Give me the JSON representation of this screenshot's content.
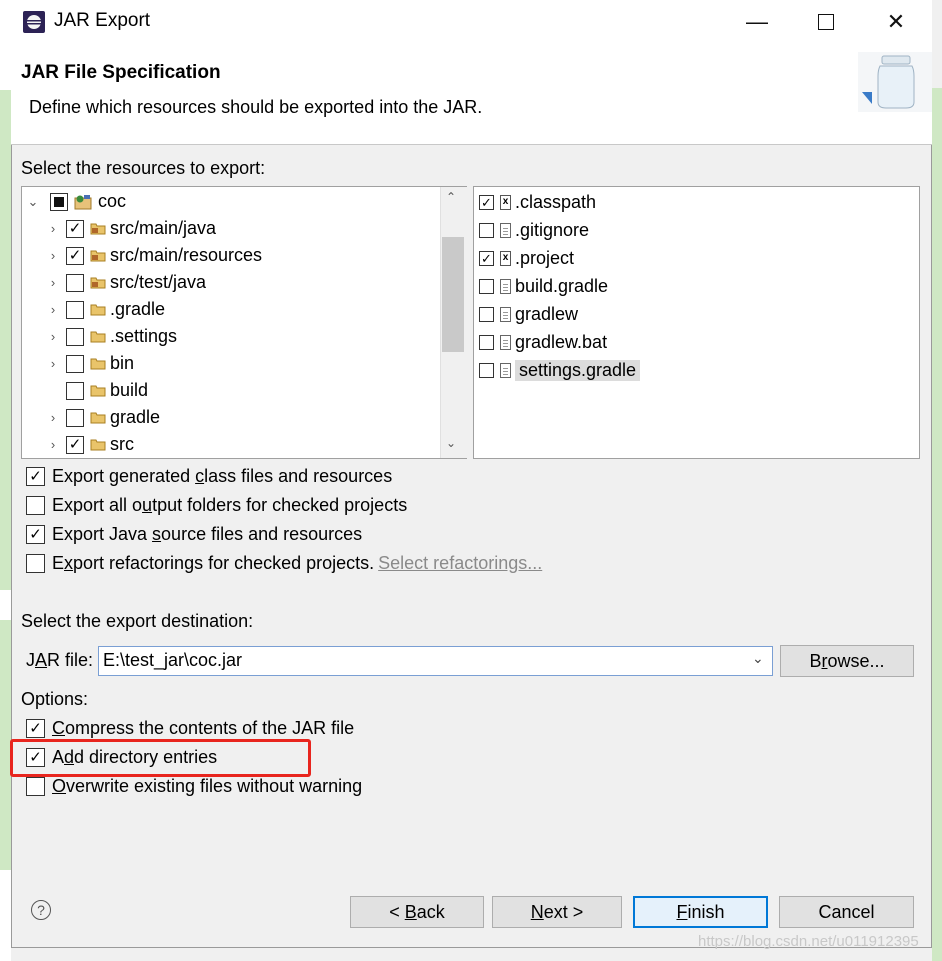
{
  "window": {
    "title": "JAR Export",
    "minimize_icon": "minimize-icon",
    "maximize_icon": "maximize-icon",
    "close_icon": "close-icon"
  },
  "header": {
    "title": "JAR File Specification",
    "description": "Define which resources should be exported into the JAR."
  },
  "resources": {
    "label": "Select the resources to export:",
    "tree": [
      {
        "label": "coc",
        "state": "partial",
        "icon": "project-icon",
        "expanded": true
      },
      {
        "label": "src/main/java",
        "state": "checked",
        "icon": "package-folder-icon"
      },
      {
        "label": "src/main/resources",
        "state": "checked",
        "icon": "package-folder-icon"
      },
      {
        "label": "src/test/java",
        "state": "unchecked",
        "icon": "package-folder-icon"
      },
      {
        "label": ".gradle",
        "state": "unchecked",
        "icon": "folder-icon"
      },
      {
        "label": ".settings",
        "state": "unchecked",
        "icon": "folder-icon"
      },
      {
        "label": "bin",
        "state": "unchecked",
        "icon": "folder-icon"
      },
      {
        "label": "build",
        "state": "unchecked",
        "icon": "folder-icon"
      },
      {
        "label": "gradle",
        "state": "unchecked",
        "icon": "folder-icon"
      },
      {
        "label": "src",
        "state": "checked",
        "icon": "folder-icon"
      }
    ],
    "files": [
      {
        "label": ".classpath",
        "checked": true,
        "icon": "xml-file-icon"
      },
      {
        "label": ".gitignore",
        "checked": false,
        "icon": "text-file-icon"
      },
      {
        "label": ".project",
        "checked": true,
        "icon": "xml-file-icon"
      },
      {
        "label": "build.gradle",
        "checked": false,
        "icon": "text-file-icon"
      },
      {
        "label": "gradlew",
        "checked": false,
        "icon": "text-file-icon"
      },
      {
        "label": "gradlew.bat",
        "checked": false,
        "icon": "text-file-icon"
      },
      {
        "label": "settings.gradle",
        "checked": false,
        "icon": "text-file-icon",
        "selected": true
      }
    ]
  },
  "export_options": {
    "class_files": {
      "pre": "Export generated ",
      "mn": "c",
      "post": "lass files and resources",
      "checked": true
    },
    "output_folders": {
      "pre": "Export all o",
      "mn": "u",
      "post": "tput folders for checked projects",
      "checked": false
    },
    "source_files": {
      "pre": "Export Java ",
      "mn": "s",
      "post": "ource files and resources",
      "checked": true
    },
    "refactorings": {
      "pre": "E",
      "mn": "x",
      "post": "port refactorings for checked projects.",
      "checked": false,
      "link": "Select refactorings..."
    }
  },
  "destination": {
    "label": "Select the export destination:",
    "jar_label_pre": "J",
    "jar_label_mn": "A",
    "jar_label_post": "R file:",
    "jar_value": "E:\\test_jar\\coc.jar",
    "browse_pre": "B",
    "browse_mn": "r",
    "browse_post": "owse..."
  },
  "options": {
    "label": "Options:",
    "compress": {
      "pre": "",
      "mn": "C",
      "post": "ompress the contents of the JAR file",
      "checked": true
    },
    "directory_entries": {
      "pre": "A",
      "mn": "d",
      "post": "d directory entries",
      "checked": true
    },
    "overwrite": {
      "pre": "",
      "mn": "O",
      "post": "verwrite existing files without warning",
      "checked": false
    }
  },
  "buttons": {
    "back_pre": "< ",
    "back_mn": "B",
    "back_post": "ack",
    "next_mn": "N",
    "next_post": "ext >",
    "finish_mn": "F",
    "finish_post": "inish",
    "cancel": "Cancel",
    "help_icon": "help-icon"
  },
  "watermark": "https://blog.csdn.net/u011912395",
  "colors": {
    "highlight_box": "#e8251e",
    "default_button_border": "#0078d7"
  }
}
